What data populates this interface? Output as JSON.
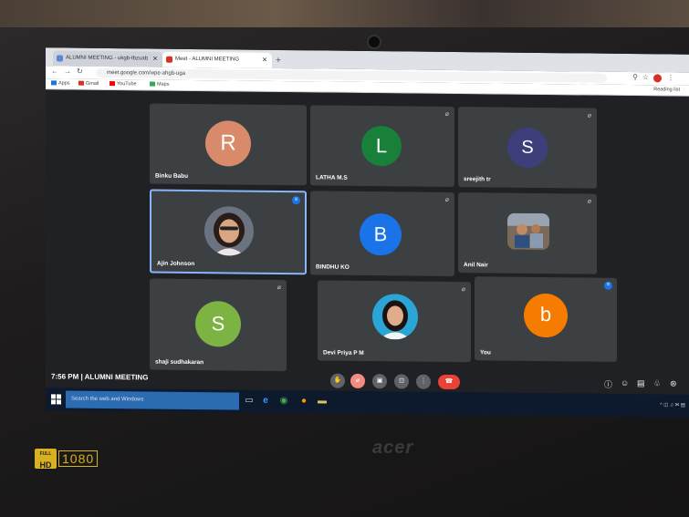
{
  "browser": {
    "tabs": [
      {
        "label": "ALUMNI MEETING - ukgb-tbzuab",
        "fav_color": "#5a86d6"
      },
      {
        "label": "Meet - ALUMNI MEETING",
        "fav_color": "#d93025"
      }
    ],
    "url": "meet.google.com/wpe-ahgb-uga",
    "bookmarks": [
      {
        "label": "Apps",
        "icon": "apps-grid-icon",
        "color": "#1a73e8"
      },
      {
        "label": "Gmail",
        "icon": "gmail-icon",
        "color": "#d93025"
      },
      {
        "label": "YouTube",
        "icon": "youtube-icon",
        "color": "#ff0000"
      },
      {
        "label": "Maps",
        "icon": "maps-icon",
        "color": "#34a853"
      }
    ],
    "reading_list": "Reading list"
  },
  "participants": [
    {
      "name": "Binku Babu",
      "initial": "R",
      "color": "#d98a6a"
    },
    {
      "name": "LATHA M.S",
      "initial": "L",
      "color": "#188038"
    },
    {
      "name": "sreejith tr",
      "initial": "S",
      "color": "#3c3f7a"
    },
    {
      "name": "Ajin Johnson",
      "initial": "",
      "color": ""
    },
    {
      "name": "BINDHU KO",
      "initial": "B",
      "color": "#1a73e8"
    },
    {
      "name": "Anil Nair",
      "initial": "",
      "color": ""
    },
    {
      "name": "shaji sudhakaran",
      "initial": "S",
      "color": "#7cb342"
    },
    {
      "name": "Devi Priya P M",
      "initial": "",
      "color": ""
    },
    {
      "name": "You",
      "initial": "b",
      "color": "#f57c00"
    }
  ],
  "meeting": {
    "clock": "7:56 PM",
    "separator": "|",
    "title": "ALUMNI MEETING",
    "end_call_color": "#ea4335"
  },
  "taskbar": {
    "search_placeholder": "Search the web and Windows"
  },
  "device": {
    "hd_top": "FULL",
    "hd_label": "HD",
    "resolution": "1080",
    "brand": "acer"
  }
}
